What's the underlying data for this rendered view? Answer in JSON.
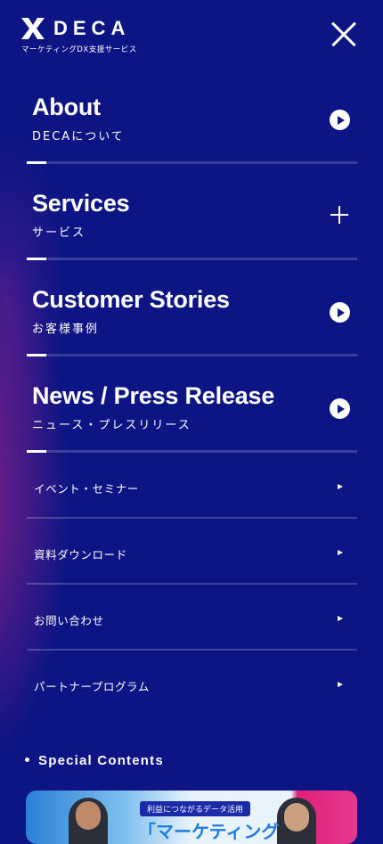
{
  "header": {
    "logo_text": "DECA",
    "logo_sub": "マーケティングDX支援サービス"
  },
  "menu": {
    "main_items": [
      {
        "title": "About",
        "sub": "DECAについて",
        "icon": "play-circle-icon"
      },
      {
        "title": "Services",
        "sub": "サービス",
        "icon": "plus-icon"
      },
      {
        "title": "Customer Stories",
        "sub": "お客様事例",
        "icon": "play-circle-icon"
      },
      {
        "title": "News / Press Release",
        "sub": "ニュース・プレスリリース",
        "icon": "play-circle-icon"
      }
    ],
    "sub_items": [
      {
        "label": "イベント・セミナー"
      },
      {
        "label": "資料ダウンロード"
      },
      {
        "label": "お問い合わせ"
      },
      {
        "label": "パートナープログラム"
      }
    ]
  },
  "special": {
    "heading": "Special Contents"
  },
  "banner": {
    "tag": "利益につながるデータ活用",
    "headline": "「マーケティング"
  },
  "colors": {
    "background": "#0d1584",
    "accent_pink": "#e0207a",
    "text": "#ffffff"
  }
}
